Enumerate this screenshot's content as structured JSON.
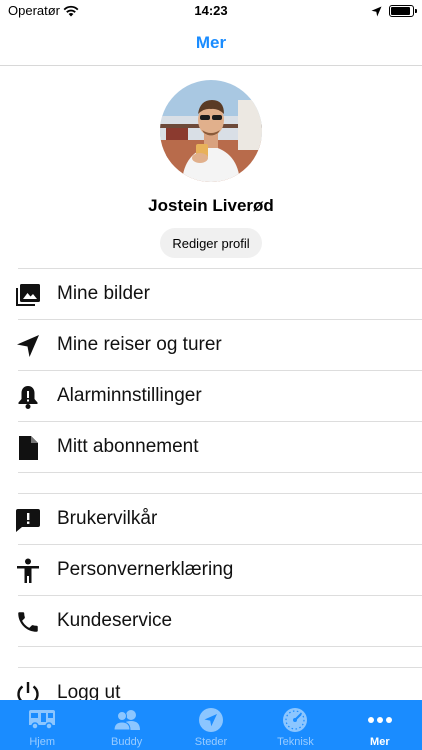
{
  "status_bar": {
    "carrier": "Operatør",
    "time": "14:23"
  },
  "nav": {
    "title": "Mer"
  },
  "profile": {
    "name": "Jostein Liverød",
    "edit_label": "Rediger profil"
  },
  "menu": {
    "sections": [
      [
        {
          "label": "Mine bilder",
          "icon": "photo-library-icon"
        },
        {
          "label": "Mine reiser og turer",
          "icon": "navigation-arrow-icon"
        },
        {
          "label": "Alarminnstillinger",
          "icon": "bell-icon"
        },
        {
          "label": "Mitt abonnement",
          "icon": "document-icon"
        }
      ],
      [
        {
          "label": "Brukervilkår",
          "icon": "feedback-icon"
        },
        {
          "label": "Personvernerklæring",
          "icon": "accessibility-icon"
        },
        {
          "label": "Kundeservice",
          "icon": "phone-icon"
        }
      ],
      [
        {
          "label": "Logg ut",
          "icon": "power-icon"
        }
      ]
    ]
  },
  "tab_bar": {
    "active": "Mer",
    "tabs": [
      {
        "label": "Hjem",
        "icon": "camper-icon"
      },
      {
        "label": "Buddy",
        "icon": "people-icon"
      },
      {
        "label": "Steder",
        "icon": "navigation-circle-icon"
      },
      {
        "label": "Teknisk",
        "icon": "speedometer-icon"
      },
      {
        "label": "Mer",
        "icon": "more-dots-icon"
      }
    ]
  },
  "colors": {
    "accent": "#1a8cff",
    "tab_inactive": "#8cc6ff",
    "divider": "#dddddd"
  }
}
